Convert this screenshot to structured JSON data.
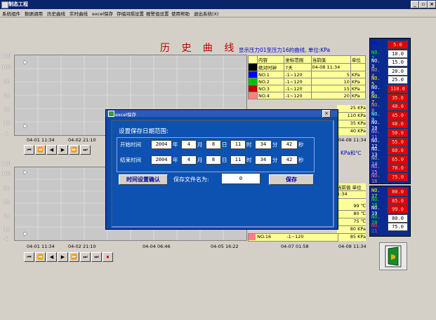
{
  "window": {
    "title": "制态工程",
    "controls": [
      "_",
      "▫",
      "×"
    ]
  },
  "menu": [
    "系统组件",
    "数据调用",
    "历史曲线",
    "实时曲线",
    "excel保存",
    "存储间隔设置",
    "报警值设置",
    "使用帮助",
    "退出系统(X)"
  ],
  "chart": {
    "title": "历 史 曲 线",
    "subtitle": "显示压力01至压力16的曲线, 单位:KPa"
  },
  "upper_plot": {
    "yticks": [
      "120",
      "100",
      "80",
      "59",
      "39",
      "19",
      "-1"
    ],
    "xticks": [
      "04-01 11:34",
      "04-02 21:10"
    ]
  },
  "lower_plot": {
    "yticks": [
      "120",
      "100",
      "80",
      "59",
      "39",
      "19",
      "-1"
    ],
    "xticks": [
      "04-01 11:34",
      "04-02 21:10",
      "04-04 06:46",
      "04-05 16:22",
      "04-07 01:58",
      "04-08 11:34"
    ]
  },
  "nav_buttons": [
    "⏮",
    "⏪",
    "◀",
    "▶",
    "⏩",
    "⏭",
    "⏹"
  ],
  "legend_top": {
    "headers": [
      "内容",
      "坐标范围",
      "当前值",
      "单位"
    ],
    "rows": [
      {
        "color": "#000000",
        "name": "绝对时钟",
        "range": "7天",
        "value": "04-08 11:34",
        "unit": ""
      },
      {
        "color": "#0000ff",
        "name": "NO.1",
        "range": "-1~120",
        "value": "5",
        "unit": "KPa"
      },
      {
        "color": "#00c000",
        "name": "NO.2",
        "range": "-1~120",
        "value": "10",
        "unit": "KPa"
      },
      {
        "color": "#c00000",
        "name": "NO.3",
        "range": "-1~120",
        "value": "15",
        "unit": "KPa"
      },
      {
        "color": "#ff8080",
        "name": "NO.4",
        "range": "-1~120",
        "value": "20",
        "unit": "KPa"
      }
    ],
    "partial_values": [
      "25 KPa",
      "110 KPa",
      "35 KPa",
      "40 KPa"
    ],
    "footer_time": "04-08 11:34",
    "footer_unit": "KPa和℃"
  },
  "legend_bottom": {
    "header": "当前值 单位",
    "values": [
      "1:34",
      "99 ℃",
      "80 ℃",
      "75 ℃",
      "80 KPa",
      "85 KPa"
    ],
    "last_row": {
      "name": "NO.16",
      "range": "-1~120"
    }
  },
  "right_panel": [
    {
      "label": "NO. 1",
      "color": "#0000ff",
      "value": "5.0",
      "bg": "#e00000",
      "fg": "#e0e0e0"
    },
    {
      "label": "NO. 2",
      "color": "#00ff00",
      "value": "10.0",
      "bg": "#ffffff",
      "fg": "#000000"
    },
    {
      "label": "NO. 3",
      "color": "#ffffff",
      "value": "15.0",
      "bg": "#ffffff",
      "fg": "#000000"
    },
    {
      "label": "NO. 4",
      "color": "#ff8080",
      "value": "20.0",
      "bg": "#ffffff",
      "fg": "#000000"
    },
    {
      "label": "NO. 5",
      "color": "#ffff00",
      "value": "25.0",
      "bg": "#ffffff",
      "fg": "#000000"
    },
    {
      "label": "NO. 6",
      "color": "#ffffff",
      "value": "110.0",
      "bg": "#e00000",
      "fg": "#e0e0e0"
    },
    {
      "label": "NO. 7",
      "color": "#ffff00",
      "value": "35.0",
      "bg": "#e00000",
      "fg": "#e0e0e0"
    },
    {
      "label": "NO. 8",
      "color": "#ff8080",
      "value": "40.0",
      "bg": "#e00000",
      "fg": "#e0e0e0"
    },
    {
      "label": "NO. 9",
      "color": "#80ffff",
      "value": "45.0",
      "bg": "#e00000",
      "fg": "#e0e0e0"
    },
    {
      "label": "NO. 10",
      "color": "#ffffff",
      "value": "48.0",
      "bg": "#e00000",
      "fg": "#e0e0e0"
    },
    {
      "label": "NO. 11",
      "color": "#ff80ff",
      "value": "50.0",
      "bg": "#e00000",
      "fg": "#e0e0e0"
    },
    {
      "label": "NO. 12",
      "color": "#ffffff",
      "value": "55.0",
      "bg": "#e00000",
      "fg": "#e0e0e0"
    },
    {
      "label": "NO. 13",
      "color": "#ffffff",
      "value": "60.0",
      "bg": "#e00000",
      "fg": "#e0e0e0"
    },
    {
      "label": "NO. 14",
      "color": "#c0c0c0",
      "value": "65.0",
      "bg": "#e00000",
      "fg": "#e0e0e0"
    },
    {
      "label": "NO. 15",
      "color": "#ff80ff",
      "value": "70.0",
      "bg": "#e00000",
      "fg": "#e0e0e0"
    },
    {
      "label": "NO. 16",
      "color": "#ff8080",
      "value": "75.0",
      "bg": "#e00000",
      "fg": "#e0e0e0"
    },
    {
      "label": "NO. 17",
      "color": "#ffff00",
      "value": "80.0",
      "bg": "#e00000",
      "fg": "#e0e0e0"
    },
    {
      "label": "NO. 18",
      "color": "#00ff00",
      "value": "85.0",
      "bg": "#e00000",
      "fg": "#e0e0e0"
    },
    {
      "label": "NO. 19",
      "color": "#ffffff",
      "value": "99.0",
      "bg": "#e00000",
      "fg": "#e0e0e0"
    },
    {
      "label": "NO. 20",
      "color": "#00ff00",
      "value": "80.0",
      "bg": "#ffffff",
      "fg": "#000000"
    },
    {
      "label": "NO. 21",
      "color": "#ff4040",
      "value": "75.0",
      "bg": "#ffffff",
      "fg": "#000000"
    }
  ],
  "dialog": {
    "title": "excel保存",
    "heading": "设置保存日期范围:",
    "start": {
      "label": "开始时间",
      "year": "2004",
      "month": "4",
      "day": "8",
      "hour": "11",
      "minute": "34",
      "second": "42"
    },
    "end": {
      "label": "结束时间",
      "year": "2004",
      "month": "4",
      "day": "8",
      "hour": "11",
      "minute": "34",
      "second": "42"
    },
    "units": {
      "year": "年",
      "month": "月",
      "day": "日",
      "hour": "时",
      "minute": "分",
      "second": "秒"
    },
    "confirm_button": "时间设置确认",
    "filename_label": "保存文件名为:",
    "filename_value": "0",
    "save_button": "保存",
    "close": "×"
  }
}
